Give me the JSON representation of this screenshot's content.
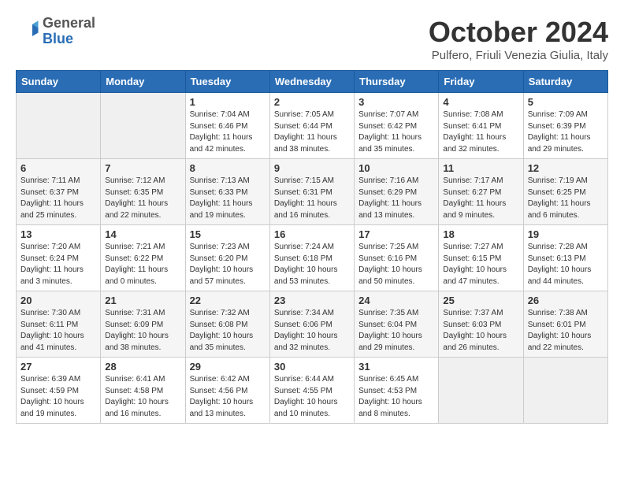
{
  "logo": {
    "general": "General",
    "blue": "Blue"
  },
  "header": {
    "month_title": "October 2024",
    "location": "Pulfero, Friuli Venezia Giulia, Italy"
  },
  "days_of_week": [
    "Sunday",
    "Monday",
    "Tuesday",
    "Wednesday",
    "Thursday",
    "Friday",
    "Saturday"
  ],
  "weeks": [
    [
      {
        "day": "",
        "info": ""
      },
      {
        "day": "",
        "info": ""
      },
      {
        "day": "1",
        "info": "Sunrise: 7:04 AM\nSunset: 6:46 PM\nDaylight: 11 hours and 42 minutes."
      },
      {
        "day": "2",
        "info": "Sunrise: 7:05 AM\nSunset: 6:44 PM\nDaylight: 11 hours and 38 minutes."
      },
      {
        "day": "3",
        "info": "Sunrise: 7:07 AM\nSunset: 6:42 PM\nDaylight: 11 hours and 35 minutes."
      },
      {
        "day": "4",
        "info": "Sunrise: 7:08 AM\nSunset: 6:41 PM\nDaylight: 11 hours and 32 minutes."
      },
      {
        "day": "5",
        "info": "Sunrise: 7:09 AM\nSunset: 6:39 PM\nDaylight: 11 hours and 29 minutes."
      }
    ],
    [
      {
        "day": "6",
        "info": "Sunrise: 7:11 AM\nSunset: 6:37 PM\nDaylight: 11 hours and 25 minutes."
      },
      {
        "day": "7",
        "info": "Sunrise: 7:12 AM\nSunset: 6:35 PM\nDaylight: 11 hours and 22 minutes."
      },
      {
        "day": "8",
        "info": "Sunrise: 7:13 AM\nSunset: 6:33 PM\nDaylight: 11 hours and 19 minutes."
      },
      {
        "day": "9",
        "info": "Sunrise: 7:15 AM\nSunset: 6:31 PM\nDaylight: 11 hours and 16 minutes."
      },
      {
        "day": "10",
        "info": "Sunrise: 7:16 AM\nSunset: 6:29 PM\nDaylight: 11 hours and 13 minutes."
      },
      {
        "day": "11",
        "info": "Sunrise: 7:17 AM\nSunset: 6:27 PM\nDaylight: 11 hours and 9 minutes."
      },
      {
        "day": "12",
        "info": "Sunrise: 7:19 AM\nSunset: 6:25 PM\nDaylight: 11 hours and 6 minutes."
      }
    ],
    [
      {
        "day": "13",
        "info": "Sunrise: 7:20 AM\nSunset: 6:24 PM\nDaylight: 11 hours and 3 minutes."
      },
      {
        "day": "14",
        "info": "Sunrise: 7:21 AM\nSunset: 6:22 PM\nDaylight: 11 hours and 0 minutes."
      },
      {
        "day": "15",
        "info": "Sunrise: 7:23 AM\nSunset: 6:20 PM\nDaylight: 10 hours and 57 minutes."
      },
      {
        "day": "16",
        "info": "Sunrise: 7:24 AM\nSunset: 6:18 PM\nDaylight: 10 hours and 53 minutes."
      },
      {
        "day": "17",
        "info": "Sunrise: 7:25 AM\nSunset: 6:16 PM\nDaylight: 10 hours and 50 minutes."
      },
      {
        "day": "18",
        "info": "Sunrise: 7:27 AM\nSunset: 6:15 PM\nDaylight: 10 hours and 47 minutes."
      },
      {
        "day": "19",
        "info": "Sunrise: 7:28 AM\nSunset: 6:13 PM\nDaylight: 10 hours and 44 minutes."
      }
    ],
    [
      {
        "day": "20",
        "info": "Sunrise: 7:30 AM\nSunset: 6:11 PM\nDaylight: 10 hours and 41 minutes."
      },
      {
        "day": "21",
        "info": "Sunrise: 7:31 AM\nSunset: 6:09 PM\nDaylight: 10 hours and 38 minutes."
      },
      {
        "day": "22",
        "info": "Sunrise: 7:32 AM\nSunset: 6:08 PM\nDaylight: 10 hours and 35 minutes."
      },
      {
        "day": "23",
        "info": "Sunrise: 7:34 AM\nSunset: 6:06 PM\nDaylight: 10 hours and 32 minutes."
      },
      {
        "day": "24",
        "info": "Sunrise: 7:35 AM\nSunset: 6:04 PM\nDaylight: 10 hours and 29 minutes."
      },
      {
        "day": "25",
        "info": "Sunrise: 7:37 AM\nSunset: 6:03 PM\nDaylight: 10 hours and 26 minutes."
      },
      {
        "day": "26",
        "info": "Sunrise: 7:38 AM\nSunset: 6:01 PM\nDaylight: 10 hours and 22 minutes."
      }
    ],
    [
      {
        "day": "27",
        "info": "Sunrise: 6:39 AM\nSunset: 4:59 PM\nDaylight: 10 hours and 19 minutes."
      },
      {
        "day": "28",
        "info": "Sunrise: 6:41 AM\nSunset: 4:58 PM\nDaylight: 10 hours and 16 minutes."
      },
      {
        "day": "29",
        "info": "Sunrise: 6:42 AM\nSunset: 4:56 PM\nDaylight: 10 hours and 13 minutes."
      },
      {
        "day": "30",
        "info": "Sunrise: 6:44 AM\nSunset: 4:55 PM\nDaylight: 10 hours and 10 minutes."
      },
      {
        "day": "31",
        "info": "Sunrise: 6:45 AM\nSunset: 4:53 PM\nDaylight: 10 hours and 8 minutes."
      },
      {
        "day": "",
        "info": ""
      },
      {
        "day": "",
        "info": ""
      }
    ]
  ]
}
